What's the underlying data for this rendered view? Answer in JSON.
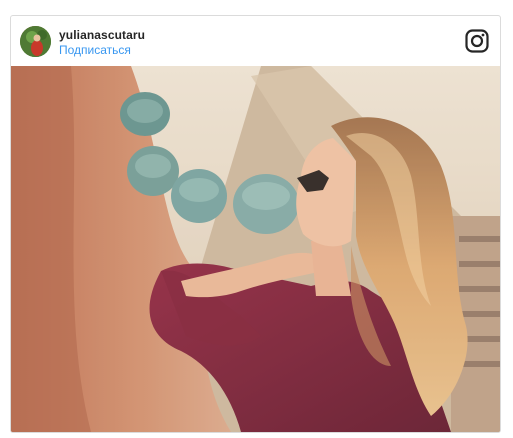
{
  "post": {
    "username": "yulianascutaru",
    "follow_label": "Подписаться",
    "header_icon": "instagram-logo-icon",
    "avatar_icon": "user-avatar",
    "photo_icon": "post-photo-woman-rooftop"
  },
  "colors": {
    "link": "#3897f0",
    "username": "#262626",
    "border": "#dbdbdb"
  }
}
